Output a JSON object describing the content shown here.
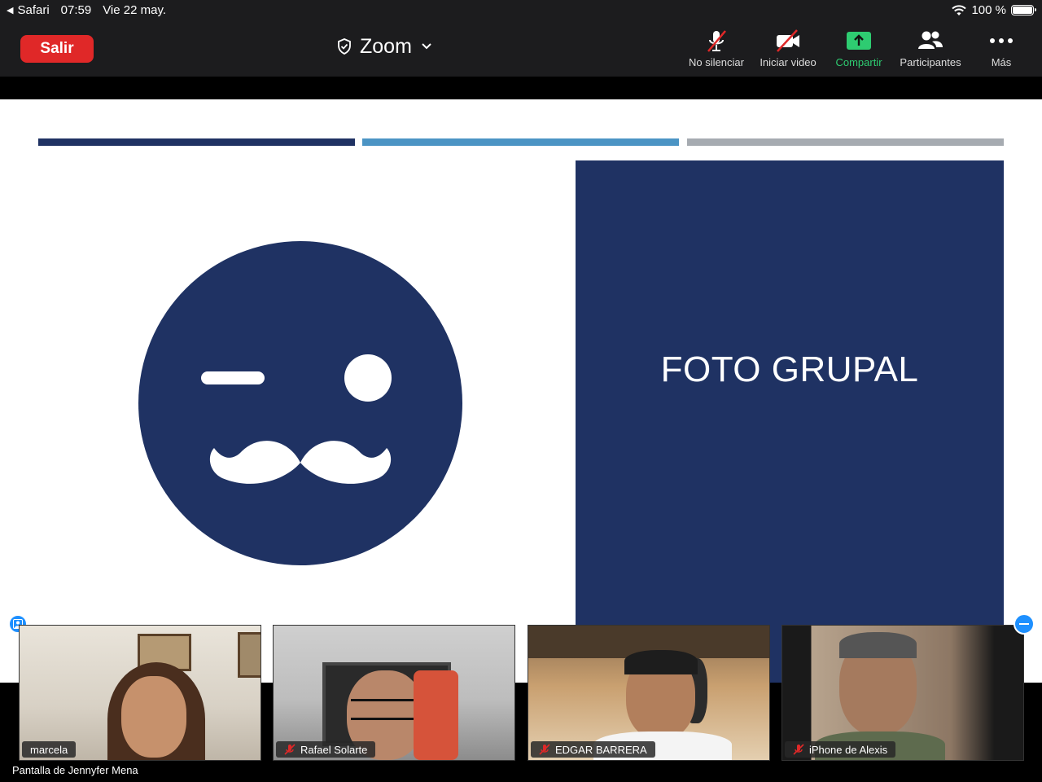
{
  "status_bar": {
    "back_app": "Safari",
    "time": "07:59",
    "date": "Vie 22 may.",
    "battery": "100 %",
    "icons": [
      "back-arrow-icon",
      "wifi-icon",
      "battery-icon"
    ]
  },
  "toolbar": {
    "leave_label": "Salir",
    "title": "Zoom",
    "title_icons": [
      "shield-icon",
      "chevron-down-icon"
    ],
    "items": [
      {
        "label": "No silenciar",
        "icon": "microphone-muted-icon"
      },
      {
        "label": "Iniciar video",
        "icon": "video-off-icon"
      },
      {
        "label": "Compartir",
        "icon": "share-screen-icon",
        "color": "#2ecc71"
      },
      {
        "label": "Participantes",
        "icon": "participants-icon"
      },
      {
        "label": "Más",
        "icon": "more-icon"
      }
    ]
  },
  "slide": {
    "title": "FOTO GRUPAL",
    "colors": {
      "navy": "#1f3263",
      "blue": "#4b94c4",
      "gray": "#a6abb1"
    },
    "graphic": "winking-mustache-face"
  },
  "participants": [
    {
      "name": "marcela",
      "muted": false
    },
    {
      "name": "Rafael Solarte",
      "muted": true
    },
    {
      "name": "EDGAR BARRERA",
      "muted": true
    },
    {
      "name": "iPhone de Alexis",
      "muted": true
    }
  ],
  "share_label": "Pantalla de Jennyfer Mena",
  "accent_color": "#1e90ff",
  "leave_color": "#e02828"
}
